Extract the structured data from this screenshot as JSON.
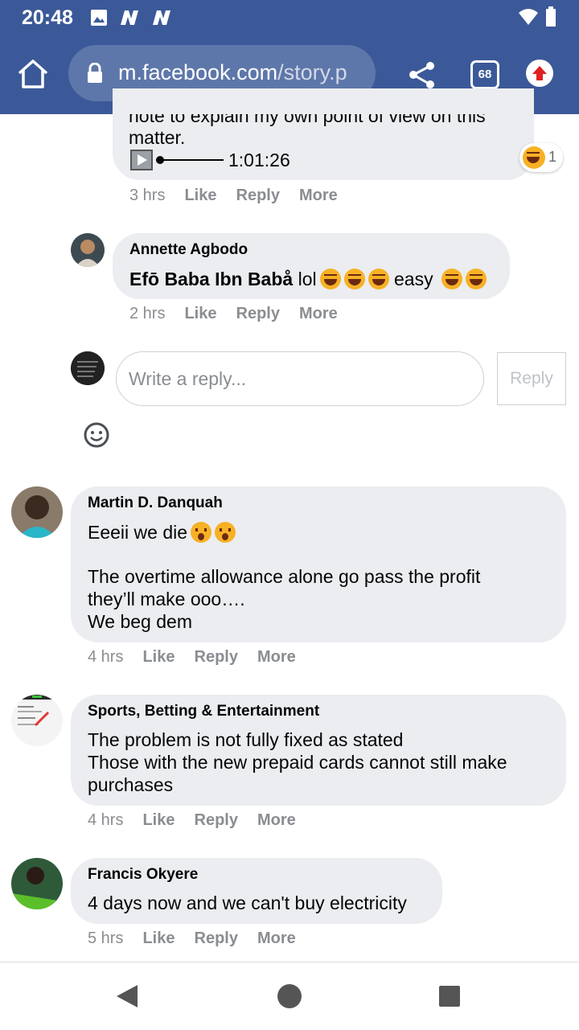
{
  "status_bar": {
    "time": "20:48"
  },
  "browser": {
    "url_domain": "m.facebook.com",
    "url_path": "/story.p",
    "tab_count": "68"
  },
  "partial_comment": {
    "text_line1": "note to explain my own point of view on this",
    "text_line2": "matter.",
    "audio_duration": "1:01:26",
    "reaction_count": "1",
    "time": "3 hrs",
    "like": "Like",
    "reply": "Reply",
    "more": "More"
  },
  "reply_annette": {
    "author": "Annette Agbodo",
    "mention": "Efō Baba Ibn Babå",
    "text1": " lol",
    "text2": " easy ",
    "time": "2 hrs",
    "like": "Like",
    "reply": "Reply",
    "more": "More"
  },
  "reply_box": {
    "placeholder": "Write a reply...",
    "button": "Reply"
  },
  "comments": [
    {
      "author": "Martin D. Danquah",
      "line1": "Eeeii we die",
      "line2": "The overtime allowance alone go pass the profit",
      "line3": "they’ll make ooo….",
      "line4": "We beg dem",
      "time": "4 hrs",
      "like": "Like",
      "reply": "Reply",
      "more": "More"
    },
    {
      "author": "Sports, Betting & Entertainment",
      "line1": "The problem is not fully fixed as stated",
      "line2": "Those with the new prepaid cards cannot still make",
      "line3": "purchases",
      "time": "4 hrs",
      "like": "Like",
      "reply": "Reply",
      "more": "More"
    },
    {
      "author": "Francis Okyere",
      "line1": "4 days now and we can't buy electricity",
      "time": "5 hrs",
      "like": "Like",
      "reply": "Reply",
      "more": "More"
    }
  ],
  "colors": {
    "facebook_blue": "#3b5998",
    "bubble": "#ebedf0",
    "meta_gray": "#8a8d91"
  }
}
